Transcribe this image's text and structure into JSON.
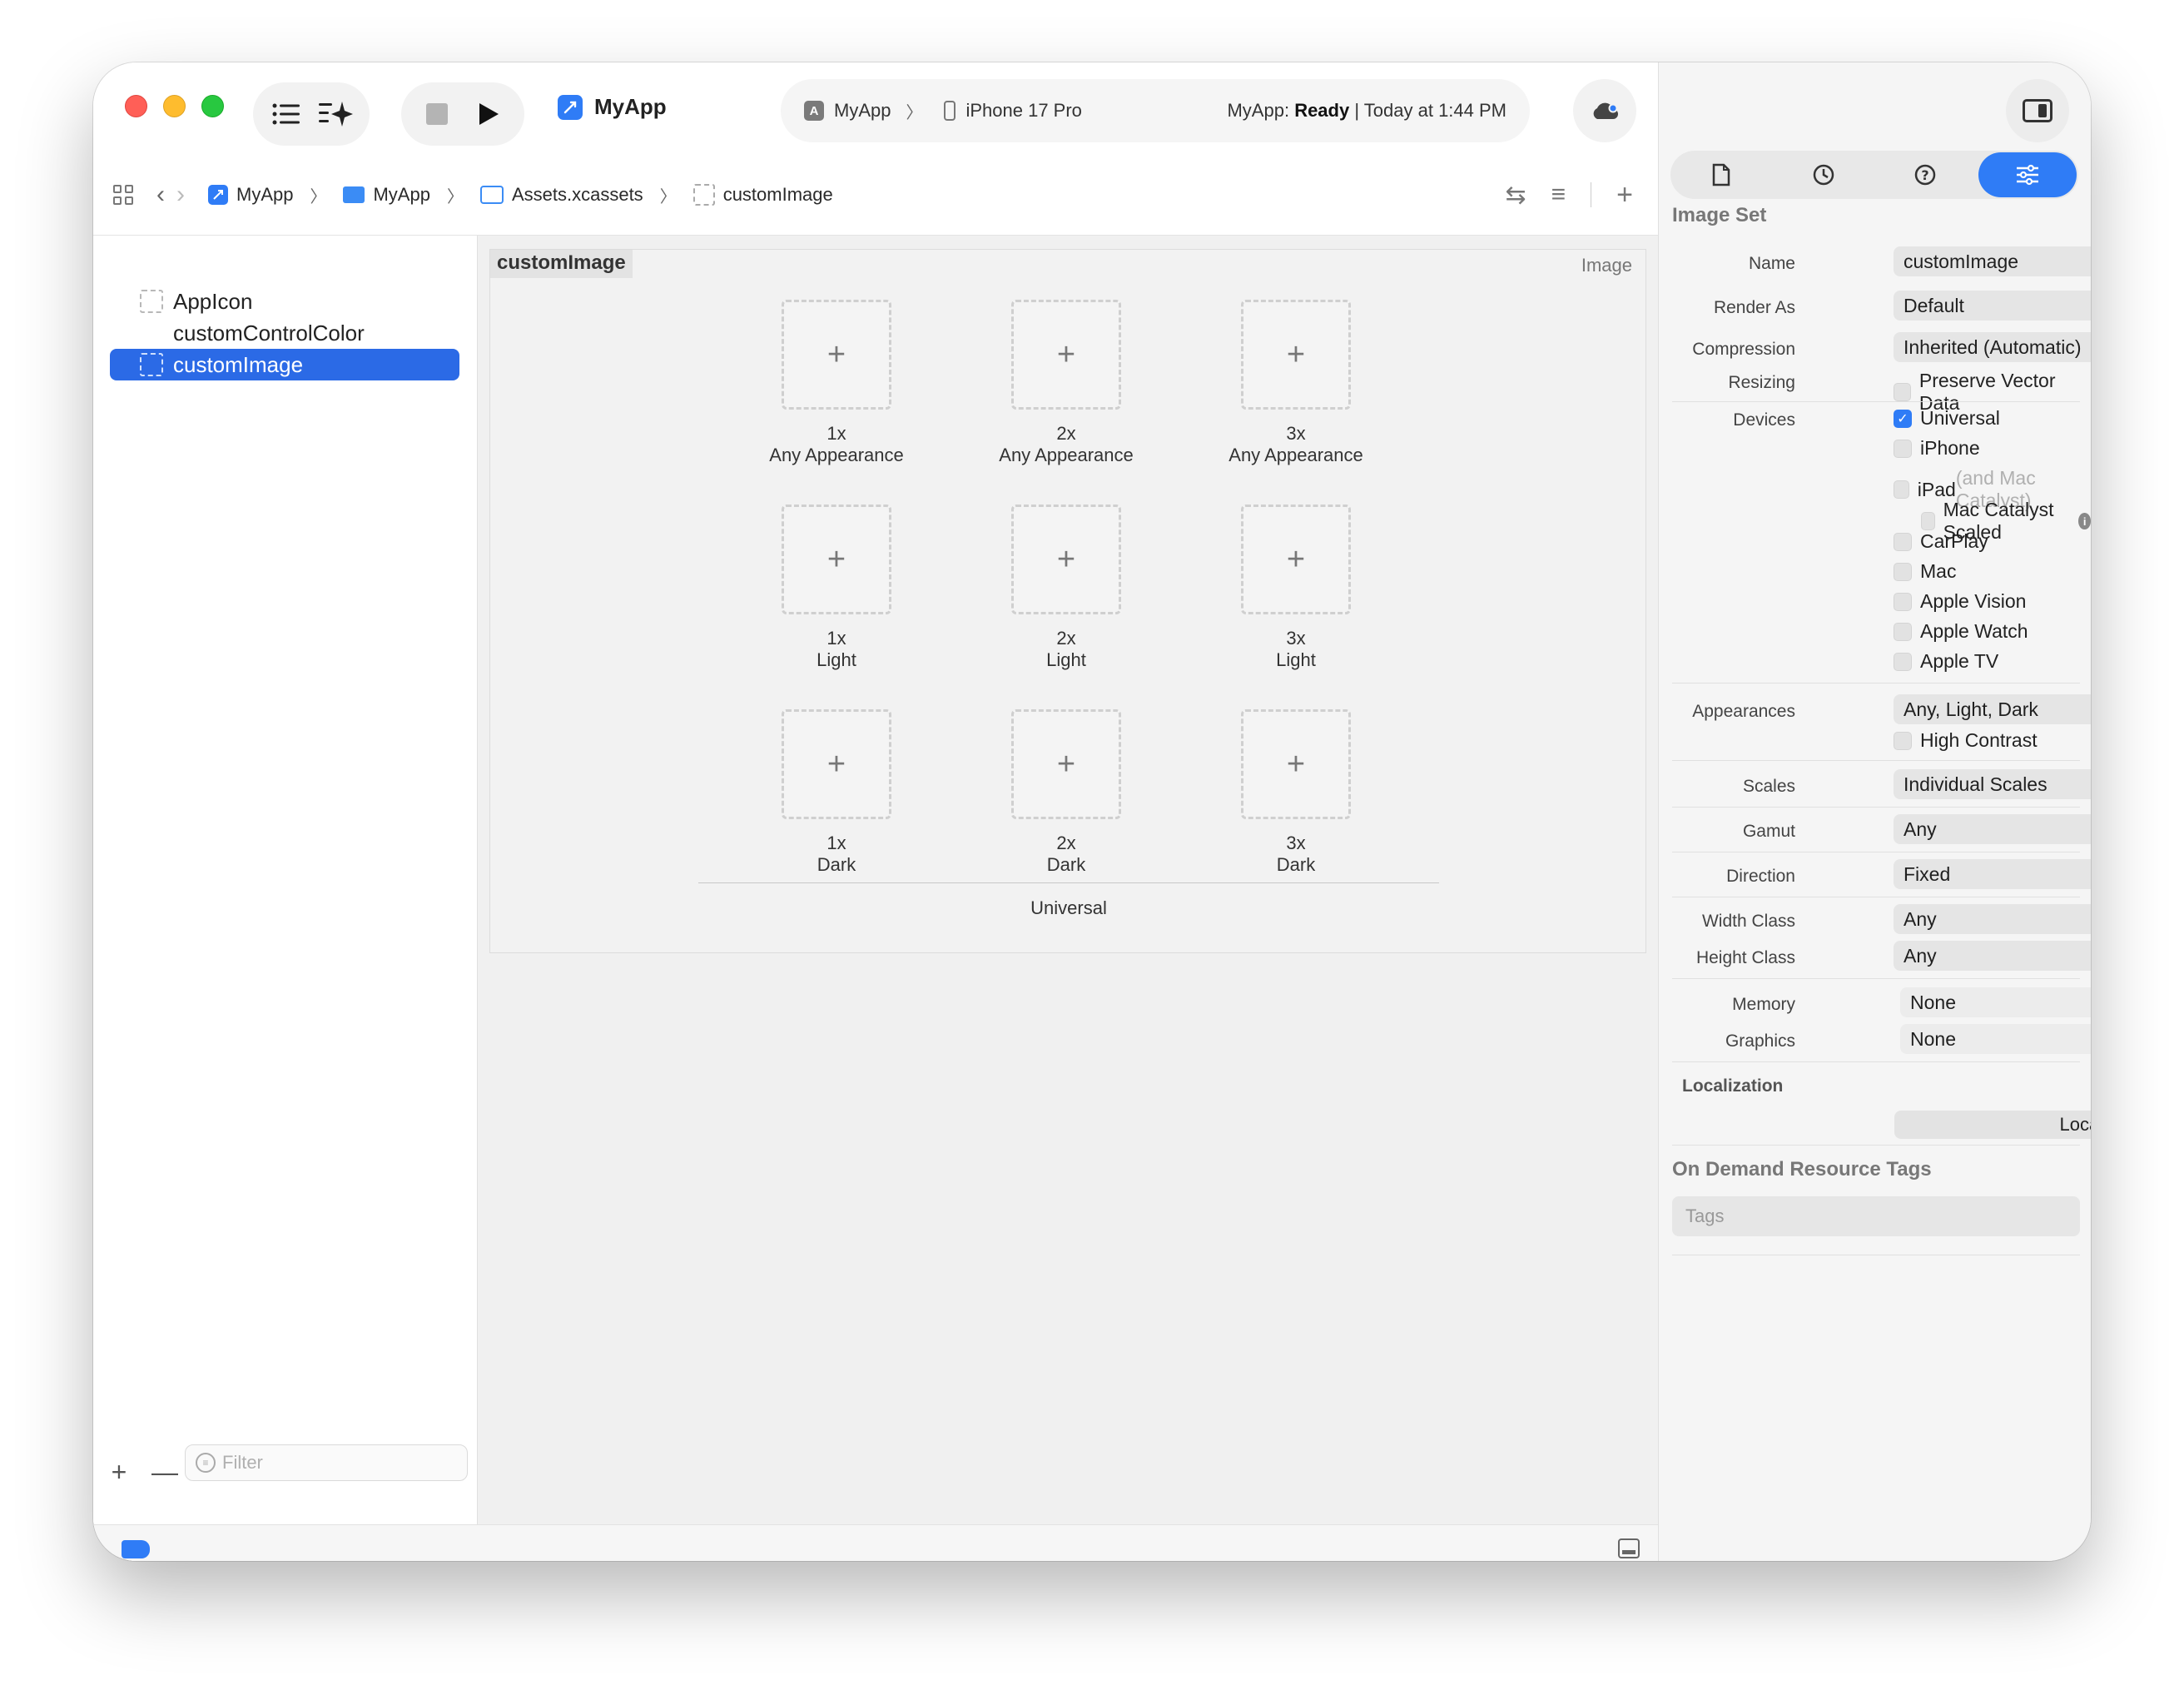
{
  "toolbar": {
    "app_name": "MyApp",
    "scheme": "MyApp",
    "destination": "iPhone 17 Pro",
    "status_app": "MyApp:",
    "status_state": "Ready",
    "status_time": "| Today at 1:44 PM"
  },
  "pathbar": {
    "crumbs": [
      "MyApp",
      "MyApp",
      "Assets.xcassets",
      "customImage"
    ]
  },
  "navigator": {
    "items": [
      {
        "label": "AppIcon"
      },
      {
        "label": "customControlColor"
      },
      {
        "label": "customImage",
        "selected": true
      }
    ],
    "filter_placeholder": "Filter"
  },
  "editor": {
    "title": "customImage",
    "type": "Image",
    "slots": [
      {
        "scale": "1x",
        "appearance": "Any Appearance"
      },
      {
        "scale": "2x",
        "appearance": "Any Appearance"
      },
      {
        "scale": "3x",
        "appearance": "Any Appearance"
      },
      {
        "scale": "1x",
        "appearance": "Light"
      },
      {
        "scale": "2x",
        "appearance": "Light"
      },
      {
        "scale": "3x",
        "appearance": "Light"
      },
      {
        "scale": "1x",
        "appearance": "Dark"
      },
      {
        "scale": "2x",
        "appearance": "Dark"
      },
      {
        "scale": "3x",
        "appearance": "Dark"
      }
    ],
    "group_label": "Universal"
  },
  "inspector": {
    "section_title": "Image Set",
    "name_label": "Name",
    "name_value": "customImage",
    "render_as_label": "Render As",
    "render_as_value": "Default",
    "compression_label": "Compression",
    "compression_value": "Inherited (Automatic)",
    "resizing_label": "Resizing",
    "resizing_option": "Preserve Vector Data",
    "devices_label": "Devices",
    "devices": {
      "universal": "Universal",
      "iphone": "iPhone",
      "ipad": "iPad",
      "ipad_note": "(and Mac Catalyst)",
      "mac_catalyst": "Mac Catalyst Scaled",
      "carplay": "CarPlay",
      "mac": "Mac",
      "vision": "Apple Vision",
      "watch": "Apple Watch",
      "tv": "Apple TV"
    },
    "appearances_label": "Appearances",
    "appearances_value": "Any, Light, Dark",
    "high_contrast": "High Contrast",
    "scales_label": "Scales",
    "scales_value": "Individual Scales",
    "gamut_label": "Gamut",
    "gamut_value": "Any",
    "direction_label": "Direction",
    "direction_value": "Fixed",
    "width_class_label": "Width Class",
    "width_class_value": "Any",
    "height_class_label": "Height Class",
    "height_class_value": "Any",
    "memory_label": "Memory",
    "memory_value": "None",
    "graphics_label": "Graphics",
    "graphics_value": "None",
    "localization_title": "Localization",
    "localize_button": "Localize...",
    "odr_title": "On Demand Resource Tags",
    "tags_placeholder": "Tags"
  },
  "colors": {
    "accent": "#2f7cf6",
    "selection": "#2b6ae6"
  }
}
